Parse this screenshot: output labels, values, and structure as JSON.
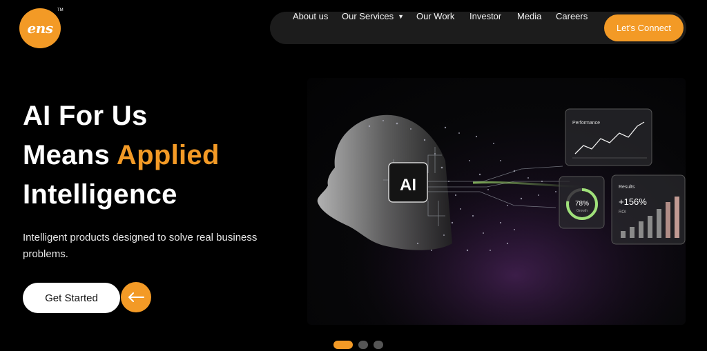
{
  "brand": {
    "logo_text": "ens",
    "trademark": "TM"
  },
  "nav": {
    "items": [
      {
        "label": "About us"
      },
      {
        "label": "Our Services"
      },
      {
        "label": "Our Work"
      },
      {
        "label": "Investor"
      },
      {
        "label": "Media"
      },
      {
        "label": "Careers"
      }
    ],
    "cta": "Let's Connect"
  },
  "hero": {
    "line1": "AI For Us",
    "line2_prefix": "Means ",
    "line2_accent": "Applied",
    "line3": "Intelligence",
    "subtext": "Intelligent products designed to solve real business problems.",
    "cta_label": "Get Started",
    "arrow_icon": "arrow-left-icon"
  },
  "illustration": {
    "chip_label": "AI",
    "performance_label": "Performance",
    "gauge_value": "78%",
    "gauge_caption": "Growth",
    "results_label": "Results",
    "results_value": "+156%",
    "results_caption": "ROI"
  },
  "carousel": {
    "count": 3,
    "active_index": 0
  },
  "colors": {
    "accent": "#f39a26",
    "background": "#000000",
    "nav_bg": "#1c1c1c"
  }
}
